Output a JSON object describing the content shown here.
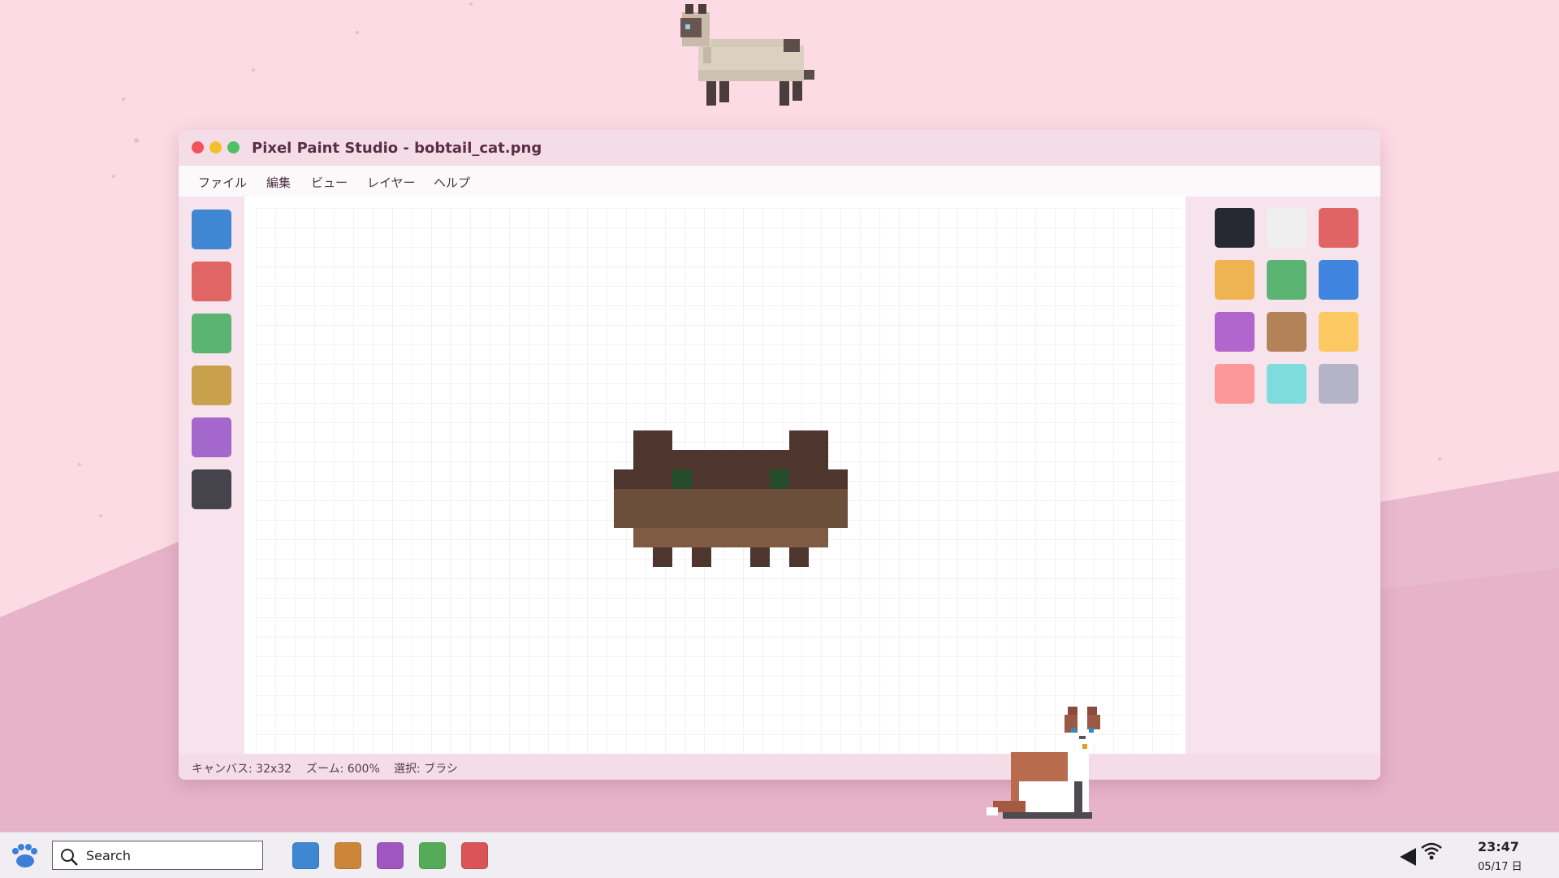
{
  "window": {
    "title": "Pixel Paint Studio - bobtail_cat.png"
  },
  "menu": {
    "items": [
      "ファイル",
      "編集",
      "ビュー",
      "レイヤー",
      "ヘルプ"
    ]
  },
  "tools": {
    "swatches": [
      "#3f86d3",
      "#e06666",
      "#5bb472",
      "#c9a04b",
      "#a467cb",
      "#45434c"
    ]
  },
  "palette": {
    "colors": [
      "#272932",
      "#efefef",
      "#e06464",
      "#f0b351",
      "#5bb472",
      "#3f84de",
      "#b265cd",
      "#b38257",
      "#fcc862",
      "#fd9898",
      "#7ddcdc",
      "#b5b4c6"
    ]
  },
  "status": {
    "canvas": "キャンバス: 32x32",
    "zoom": "ズーム: 600%",
    "selection": "選択: ブラシ"
  },
  "taskbar": {
    "search_placeholder": "Search",
    "apps": [
      "#3f86d3",
      "#cd8539",
      "#a056bf",
      "#55ab58",
      "#d95558"
    ],
    "time": "23:47",
    "date": "05/17 日"
  },
  "colors": {
    "desktop_bg": "#fddbe4",
    "hill": "#e8b6ca",
    "window_bg": "#f7e6ee",
    "accent": "#5b2e46"
  },
  "icons": {
    "launcher": "paw-icon",
    "search": "search-icon",
    "volume": "speaker-icon",
    "network": "wifi-icon"
  }
}
